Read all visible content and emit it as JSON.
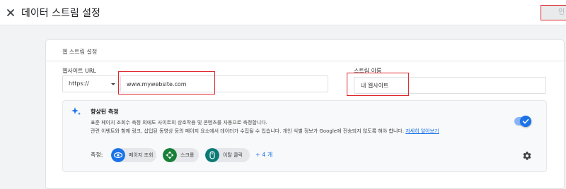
{
  "header": {
    "title": "데이터 스트림 설정",
    "action_label": "인"
  },
  "web_stream": {
    "section_title": "웹 스트림 설정",
    "website_url": {
      "label": "웹사이트 URL",
      "protocol": "https://",
      "value": "www.mywebsite.com"
    },
    "stream_name": {
      "label": "스트림 이름",
      "value": "내 웹사이트"
    }
  },
  "enhanced": {
    "title": "향상된 측정",
    "desc_line1": "표준 페이지 조회수 측정 외에도 사이트의 상호작용 및 콘텐츠를 자동으로 측정합니다.",
    "desc_line2": "관련 이벤트와 함께 링크, 삽입된 동영상 등의 페이지 요소에서 데이터가 수집될 수 있습니다. 개인 식별 정보가 Google에 전송되지 않도록 해야 합니다.",
    "learn_more": "자세히 알아보기",
    "enabled": true,
    "measures_label": "측정:",
    "chips": [
      {
        "label": "페이지 조회",
        "icon": "eye-icon",
        "color": "#1a73e8"
      },
      {
        "label": "스크롤",
        "icon": "scroll-icon",
        "color": "#188038"
      },
      {
        "label": "이탈 클릭",
        "icon": "outbound-click-icon",
        "color": "#0b7a75"
      }
    ],
    "more": "+ 4 개"
  },
  "colors": {
    "accent": "#1a73e8",
    "highlight": "#e0242c"
  }
}
